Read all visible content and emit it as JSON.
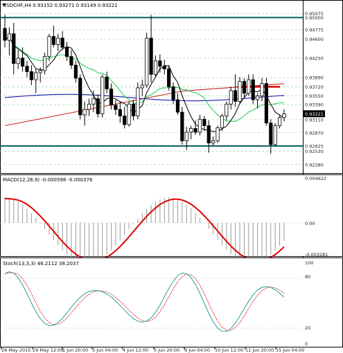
{
  "main_panel": {
    "title": "USDCHF,H4  0.93152 0.93271 0.93149 0.93221",
    "current_price_label": "0.93221",
    "price_labels": [
      "0.95075",
      "0.95000",
      "0.94775",
      "0.94600",
      "0.94250",
      "0.93890",
      "0.93720",
      "0.93550",
      "0.93390",
      "0.93221",
      "0.93110",
      "0.92870",
      "0.92625",
      "0.92530",
      "0.92280"
    ],
    "levels": {
      "top_channel": 0.95,
      "bottom_channel": 0.92625,
      "red_resistance": 0.9372
    }
  },
  "macd_panel": {
    "title": "MACD(12,26,9) -0.000598 -0.000376",
    "labels": [
      "0.004622",
      "0.00",
      "-0.003281"
    ]
  },
  "stoch_panel": {
    "title": "Stoch(13,3,3) 46.2112 38.2037",
    "labels": [
      "100",
      "80",
      "20",
      "0"
    ]
  },
  "time_axis": [
    "28 May 2015",
    "29 May 12:00",
    "1 Jun 20:00",
    "3 Jun 04:00",
    "4 Jun 12:00",
    "5 Jun 20:00",
    "9 Jun 04:00",
    "10 Jun 12:00",
    "11 Jun 20:00",
    "15 Jun 04:00"
  ],
  "colors": {
    "channel_line": "#006060",
    "red_level": "#e00000",
    "ma_blue": "#1a1aaa",
    "ma_red": "#cc2222",
    "ma_green": "#33cc66",
    "ma_black": "#111111",
    "macd_signal": "#e00000",
    "stoch_main": "#22a0a0",
    "stoch_signal": "#e00000",
    "grid": "#7ad37a"
  },
  "chart_data": {
    "type": "candlestick",
    "symbol": "USDCHF",
    "timeframe": "H4",
    "price_range": [
      0.9215,
      0.9512
    ],
    "candles": [
      [
        0.948,
        0.9505,
        0.9445,
        0.9458
      ],
      [
        0.9458,
        0.9482,
        0.943,
        0.947
      ],
      [
        0.947,
        0.949,
        0.9395,
        0.9415
      ],
      [
        0.9415,
        0.944,
        0.9405,
        0.9425
      ],
      [
        0.9425,
        0.9445,
        0.94,
        0.941
      ],
      [
        0.941,
        0.942,
        0.939,
        0.94
      ],
      [
        0.94,
        0.9412,
        0.9375,
        0.9385
      ],
      [
        0.9385,
        0.9405,
        0.936,
        0.9398
      ],
      [
        0.9398,
        0.9408,
        0.938,
        0.9402
      ],
      [
        0.9402,
        0.9435,
        0.9395,
        0.9428
      ],
      [
        0.9428,
        0.947,
        0.942,
        0.9465
      ],
      [
        0.9465,
        0.9485,
        0.9445,
        0.945
      ],
      [
        0.945,
        0.947,
        0.9438,
        0.9462
      ],
      [
        0.9462,
        0.9475,
        0.944,
        0.9445
      ],
      [
        0.9445,
        0.9455,
        0.942,
        0.9428
      ],
      [
        0.9428,
        0.944,
        0.9405,
        0.9412
      ],
      [
        0.9412,
        0.942,
        0.938,
        0.9388
      ],
      [
        0.9388,
        0.9395,
        0.9312,
        0.932
      ],
      [
        0.932,
        0.9345,
        0.93,
        0.933
      ],
      [
        0.933,
        0.935,
        0.9318,
        0.934
      ],
      [
        0.934,
        0.9365,
        0.9325,
        0.935
      ],
      [
        0.935,
        0.9358,
        0.9315,
        0.9322
      ],
      [
        0.9322,
        0.9395,
        0.9315,
        0.939
      ],
      [
        0.939,
        0.94,
        0.936,
        0.9368
      ],
      [
        0.9368,
        0.9378,
        0.933,
        0.9338
      ],
      [
        0.9338,
        0.9348,
        0.932,
        0.933
      ],
      [
        0.933,
        0.9345,
        0.9305,
        0.9318
      ],
      [
        0.9318,
        0.9335,
        0.9295,
        0.9302
      ],
      [
        0.9302,
        0.9345,
        0.9298,
        0.934
      ],
      [
        0.934,
        0.9348,
        0.931,
        0.9318
      ],
      [
        0.9318,
        0.938,
        0.9312,
        0.937
      ],
      [
        0.937,
        0.9385,
        0.9355,
        0.9375
      ],
      [
        0.9375,
        0.9472,
        0.937,
        0.9462
      ],
      [
        0.9462,
        0.9505,
        0.938,
        0.9395
      ],
      [
        0.9395,
        0.943,
        0.939,
        0.942
      ],
      [
        0.942,
        0.9432,
        0.9398,
        0.941
      ],
      [
        0.941,
        0.9422,
        0.9395,
        0.9405
      ],
      [
        0.9405,
        0.9412,
        0.9365,
        0.9372
      ],
      [
        0.9372,
        0.938,
        0.934,
        0.9348
      ],
      [
        0.9348,
        0.936,
        0.932,
        0.9325
      ],
      [
        0.9325,
        0.9335,
        0.9265,
        0.9272
      ],
      [
        0.9272,
        0.9298,
        0.9255,
        0.9288
      ],
      [
        0.9288,
        0.93,
        0.9275,
        0.9295
      ],
      [
        0.9295,
        0.931,
        0.9283,
        0.9288
      ],
      [
        0.9288,
        0.932,
        0.9282,
        0.9312
      ],
      [
        0.9312,
        0.9318,
        0.929,
        0.93
      ],
      [
        0.93,
        0.931,
        0.925,
        0.9268
      ],
      [
        0.9268,
        0.928,
        0.9262,
        0.9272
      ],
      [
        0.9272,
        0.93,
        0.9268,
        0.9296
      ],
      [
        0.9296,
        0.9322,
        0.929,
        0.9318
      ],
      [
        0.9318,
        0.9345,
        0.931,
        0.934
      ],
      [
        0.934,
        0.9372,
        0.933,
        0.9365
      ],
      [
        0.9365,
        0.9395,
        0.9335,
        0.9345
      ],
      [
        0.9345,
        0.939,
        0.934,
        0.9382
      ],
      [
        0.9382,
        0.9388,
        0.9352,
        0.936
      ],
      [
        0.936,
        0.9395,
        0.9355,
        0.9385
      ],
      [
        0.9385,
        0.9395,
        0.934,
        0.9348
      ],
      [
        0.9348,
        0.936,
        0.9332,
        0.9355
      ],
      [
        0.9355,
        0.9388,
        0.9345,
        0.9378
      ],
      [
        0.9378,
        0.9388,
        0.93,
        0.9305
      ],
      [
        0.9305,
        0.9312,
        0.9248,
        0.9265
      ],
      [
        0.9265,
        0.9305,
        0.9262,
        0.93
      ],
      [
        0.93,
        0.932,
        0.9295,
        0.9315
      ],
      [
        0.9315,
        0.933,
        0.9308,
        0.9322
      ]
    ]
  }
}
